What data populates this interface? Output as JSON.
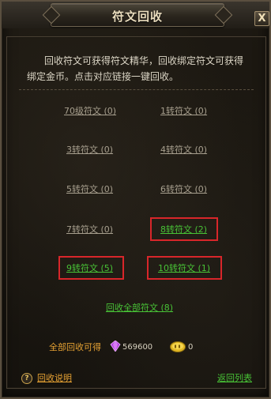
{
  "window": {
    "title": "符文回收",
    "close_label": "X"
  },
  "description": "回收符文可获得符文精华，回收绑定符文可获得绑定金币。点击对应链接一键回收。",
  "runes": {
    "r70": "70级符文 (0)",
    "r1": "1转符文 (0)",
    "r3": "3转符文 (0)",
    "r4": "4转符文 (0)",
    "r5": "5转符文 (0)",
    "r6": "6转符文 (0)",
    "r7": "7转符文 (0)",
    "r8": "8转符文 (2)",
    "r9": "9转符文 (5)",
    "r10": "10转符文 (1)"
  },
  "reclaim_all": "回收全部符文 (8)",
  "totals": {
    "label": "全部回收可得",
    "gem_value": "569600",
    "gold_value": "0",
    "gem_icon": "purple-gem-icon",
    "gold_icon": "gold-coin-icon"
  },
  "footer": {
    "help_icon": "?",
    "help_label": "回收说明",
    "back_label": "返回列表"
  },
  "colors": {
    "link_green": "#48c236",
    "link_gray": "#a79f8e",
    "highlight_red": "#d8262a",
    "accent_orange": "#e6a233"
  }
}
